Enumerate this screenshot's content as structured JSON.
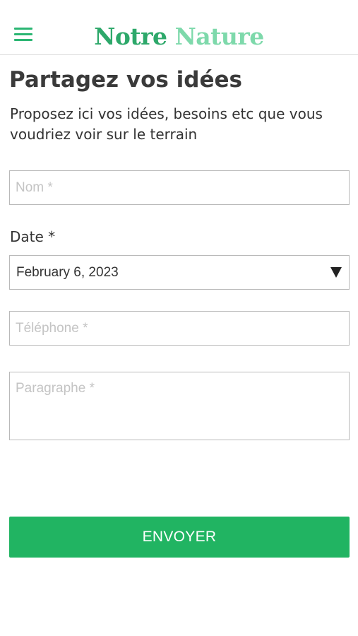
{
  "header": {
    "logo_word_1": "Notre",
    "logo_word_2": "Nature",
    "menu_icon": "hamburger-menu-icon"
  },
  "main": {
    "title": "Partagez vos idées",
    "subtitle": "Proposez ici vos idées, besoins etc que vous voudriez voir sur le terrain"
  },
  "form": {
    "name": {
      "placeholder": "Nom *",
      "value": ""
    },
    "date": {
      "label": "Date *",
      "value": "February 6, 2023",
      "icon": "dropdown-arrow-icon"
    },
    "phone": {
      "placeholder": "Téléphone *",
      "value": ""
    },
    "paragraph": {
      "placeholder": "Paragraphe *",
      "value": ""
    },
    "submit_label": "ENVOYER"
  },
  "colors": {
    "brand_green": "#2da86a",
    "brand_light_green": "#7ed9ab",
    "button_green": "#21b462"
  }
}
